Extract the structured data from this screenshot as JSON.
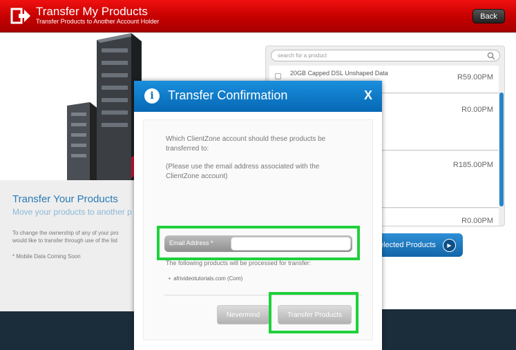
{
  "header": {
    "title": "Transfer My Products",
    "subtitle": "Transfer Products to Another Account Holder",
    "back_label": "Back"
  },
  "intro": {
    "title": "Transfer Your Products",
    "subtitle": "Move your products to another p",
    "body_line1": "To change the ownership of any of your pro",
    "body_line2": "would like to transfer through use of the list",
    "note": "* Mobile Data Coming Soon"
  },
  "products": {
    "search_placeholder": "search for a product",
    "first_item_name": "20GB Capped DSL Unshaped Data",
    "prices": [
      "R59.00PM",
      "R0.00PM",
      "R185.00PM",
      "R0.00PM"
    ],
    "selected_button_label": "elected Products"
  },
  "dialog": {
    "title": "Transfer Confirmation",
    "close_label": "X",
    "question": "Which ClientZone account should these products be transferred to:",
    "hint": "(Please use the email address associated with the ClientZone account)",
    "email_label": "Email Address *",
    "email_value": "",
    "process_text": "The following products will be processed for transfer:",
    "items": [
      "afrivideotutorials.com (Com)"
    ],
    "nevermind_label": "Nevermind",
    "transfer_label": "Transfer Products"
  },
  "colors": {
    "header_red": "#d40000",
    "accent_blue": "#0b6cb7",
    "highlight_green": "#1ed13a"
  }
}
